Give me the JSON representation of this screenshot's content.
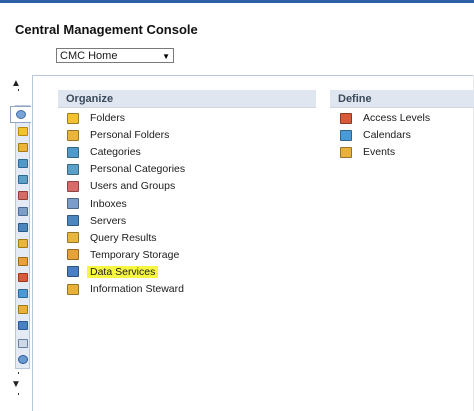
{
  "header": {
    "title": "Central Management Console",
    "nav_selected": "CMC Home",
    "nav_arrow": "▼"
  },
  "rail": {
    "up": "▲",
    "down": "▼"
  },
  "organize": {
    "title": "Organize",
    "items": [
      {
        "label": "Folders",
        "icon": "folder-icon",
        "color": "#f2c230"
      },
      {
        "label": "Personal Folders",
        "icon": "personal-folder-icon",
        "color": "#e9b53a"
      },
      {
        "label": "Categories",
        "icon": "categories-icon",
        "color": "#4f9acb"
      },
      {
        "label": "Personal Categories",
        "icon": "personal-categories-icon",
        "color": "#5aa0c8"
      },
      {
        "label": "Users and Groups",
        "icon": "users-groups-icon",
        "color": "#d86a6a"
      },
      {
        "label": "Inboxes",
        "icon": "inbox-icon",
        "color": "#7c9cc9"
      },
      {
        "label": "Servers",
        "icon": "servers-icon",
        "color": "#4a86c0"
      },
      {
        "label": "Query Results",
        "icon": "query-results-icon",
        "color": "#e6b640"
      },
      {
        "label": "Temporary Storage",
        "icon": "temporary-storage-icon",
        "color": "#e8a23a"
      },
      {
        "label": "Data Services",
        "icon": "data-services-icon",
        "color": "#4a7fc4"
      },
      {
        "label": "Information Steward",
        "icon": "information-steward-icon",
        "color": "#e8b23a"
      }
    ]
  },
  "define": {
    "title": "Define",
    "items": [
      {
        "label": "Access Levels",
        "icon": "access-levels-icon",
        "color": "#d95a3a"
      },
      {
        "label": "Calendars",
        "icon": "calendars-icon",
        "color": "#4a9ad8"
      },
      {
        "label": "Events",
        "icon": "events-icon",
        "color": "#e8b23a"
      }
    ]
  },
  "highlight_color": "#f7f742"
}
